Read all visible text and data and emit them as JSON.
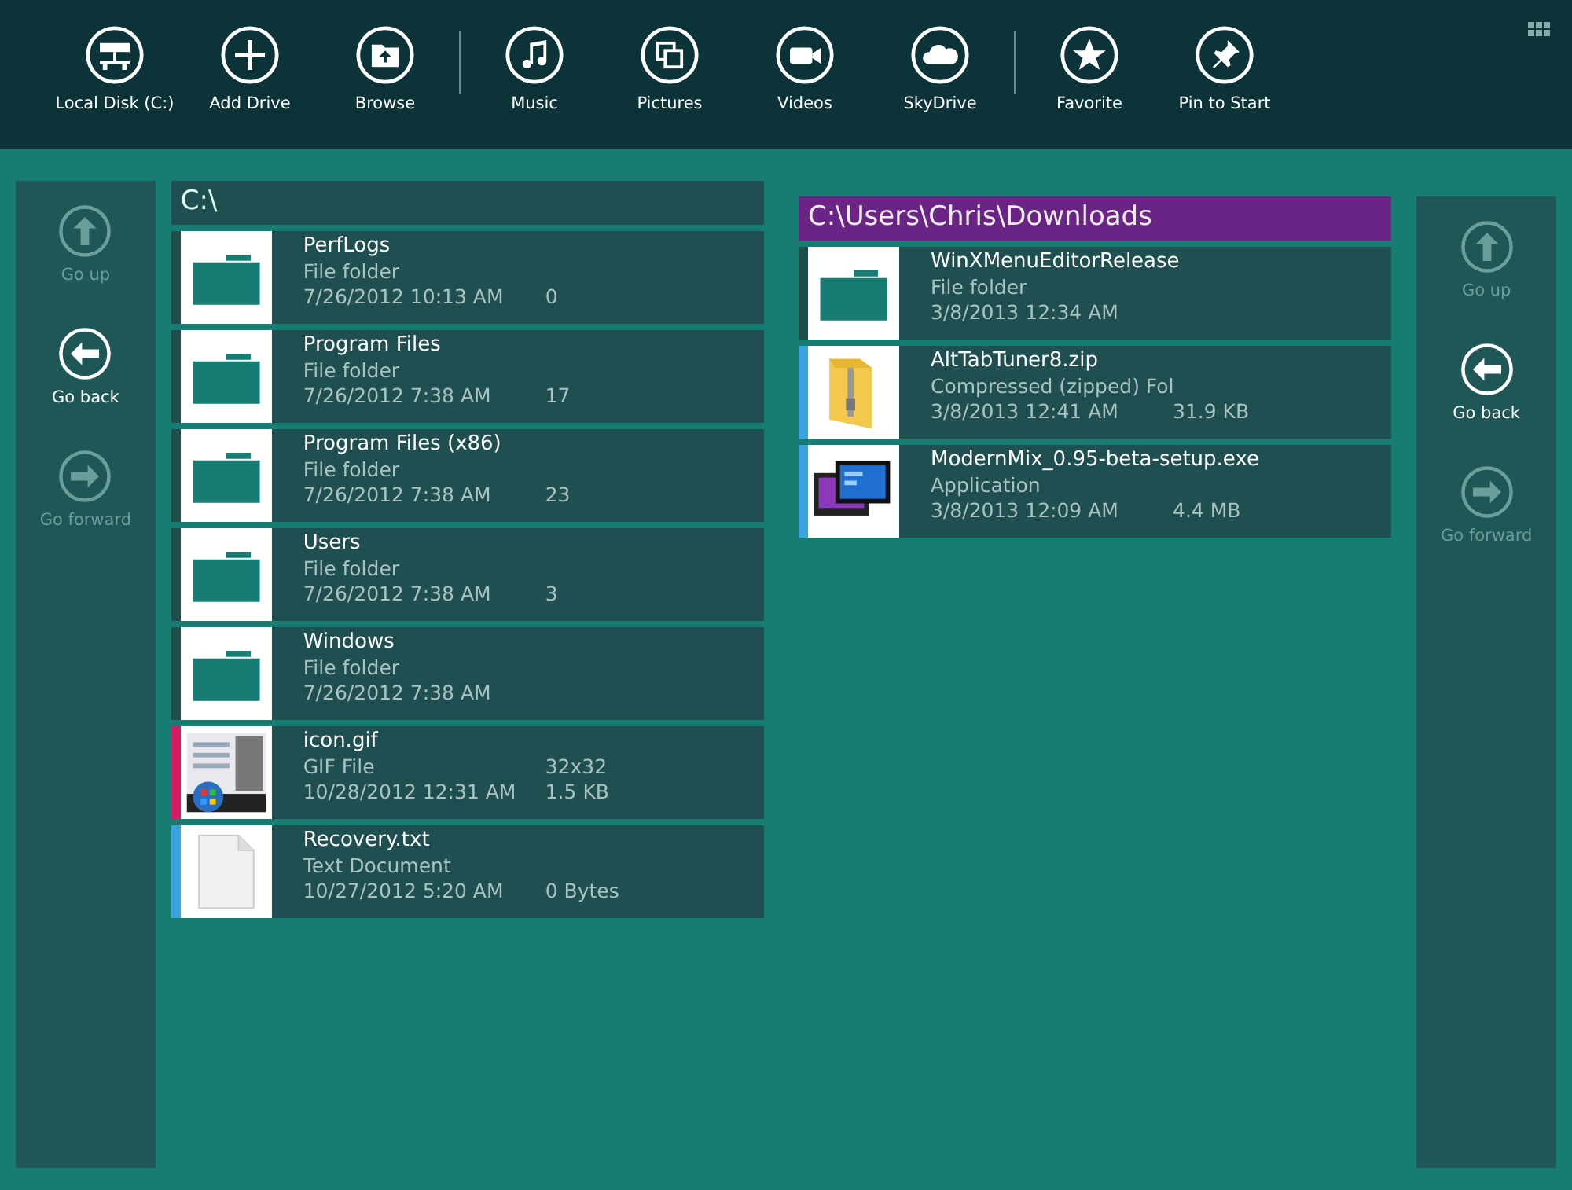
{
  "toolbar_groups": [
    {
      "buttons": [
        {
          "label": "Local Disk (C:)",
          "kind": "disk"
        },
        {
          "label": "Add Drive",
          "kind": "plus"
        },
        {
          "label": "Browse",
          "kind": "browse"
        }
      ]
    },
    {
      "buttons": [
        {
          "label": "Music",
          "kind": "music"
        },
        {
          "label": "Pictures",
          "kind": "pictures"
        },
        {
          "label": "Videos",
          "kind": "video"
        },
        {
          "label": "SkyDrive",
          "kind": "cloud"
        }
      ]
    },
    {
      "buttons": [
        {
          "label": "Favorite",
          "kind": "star"
        },
        {
          "label": "Pin to Start",
          "kind": "pin"
        }
      ]
    }
  ],
  "left_nav": [
    {
      "label": "Go up",
      "kind": "up",
      "disabled": true
    },
    {
      "label": "Go back",
      "kind": "back",
      "disabled": false
    },
    {
      "label": "Go forward",
      "kind": "forward",
      "disabled": true
    }
  ],
  "panels": [
    {
      "path": "C:\\",
      "selected": false,
      "items": [
        {
          "name": "PerfLogs",
          "kind": "folder",
          "type": "File folder",
          "date": "7/26/2012 10:13 AM",
          "size": "0"
        },
        {
          "name": "Program Files",
          "kind": "folder",
          "type": "File folder",
          "date": "7/26/2012 7:38 AM",
          "size": "17"
        },
        {
          "name": "Program Files (x86)",
          "kind": "folder",
          "type": "File folder",
          "date": "7/26/2012 7:38 AM",
          "size": "23"
        },
        {
          "name": "Users",
          "kind": "folder",
          "type": "File folder",
          "date": "7/26/2012 7:38 AM",
          "size": "3"
        },
        {
          "name": "Windows",
          "kind": "folder",
          "type": "File folder",
          "date": "7/26/2012 7:38 AM"
        },
        {
          "name": "icon.gif",
          "kind": "image",
          "color": "#d81b60",
          "type": "GIF File",
          "dimensions": "32x32",
          "date": "10/28/2012 12:31 AM",
          "size": "1.5 KB"
        },
        {
          "name": "Recovery.txt",
          "kind": "document",
          "color": "#3ba3e0",
          "type": "Text Document",
          "date": "10/27/2012 5:20 AM",
          "size": "0 Bytes"
        }
      ]
    },
    {
      "path": "C:\\Users\\Chris\\Downloads",
      "selected": true,
      "items": [
        {
          "name": "WinXMenuEditorRelease",
          "kind": "folder",
          "type": "File folder",
          "date": "3/8/2013 12:34 AM"
        },
        {
          "name": "AltTabTuner8.zip",
          "kind": "zip",
          "color": "#3ba3e0",
          "type": "Compressed (zipped) Fol",
          "date": "3/8/2013 12:41 AM",
          "size": "31.9 KB"
        },
        {
          "name": "ModernMix_0.95-beta-setup.exe",
          "kind": "app",
          "color": "#3ba3e0",
          "type": "Application",
          "date": "3/8/2013 12:09 AM",
          "size": "4.4 MB"
        }
      ]
    }
  ],
  "right_nav": [
    {
      "label": "Go up",
      "kind": "up",
      "disabled": true
    },
    {
      "label": "Go back",
      "kind": "back",
      "disabled": false
    },
    {
      "label": "Go forward",
      "kind": "forward",
      "disabled": true
    }
  ]
}
